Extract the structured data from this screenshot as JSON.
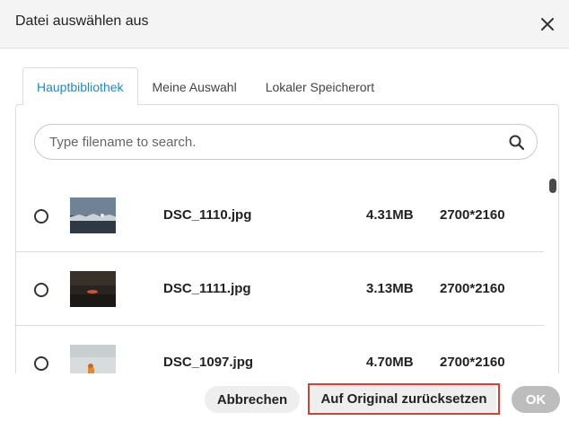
{
  "dialog": {
    "title": "Datei auswählen aus"
  },
  "tabs": [
    {
      "label": "Hauptbibliothek",
      "active": true
    },
    {
      "label": "Meine Auswahl",
      "active": false
    },
    {
      "label": "Lokaler Speicherort",
      "active": false
    }
  ],
  "search": {
    "placeholder": "Type filename to search.",
    "value": ""
  },
  "files": [
    {
      "name": "DSC_1110.jpg",
      "size": "4.31MB",
      "dimensions": "2700*2160",
      "selected": false
    },
    {
      "name": "DSC_1111.jpg",
      "size": "3.13MB",
      "dimensions": "2700*2160",
      "selected": false
    },
    {
      "name": "DSC_1097.jpg",
      "size": "4.70MB",
      "dimensions": "2700*2160",
      "selected": false
    }
  ],
  "footer": {
    "cancel_label": "Abbrechen",
    "reset_label": "Auf Original zurücksetzen",
    "ok_label": "OK"
  },
  "colors": {
    "accent": "#1c8ad4",
    "highlight_border": "#e33a2a",
    "ok_disabled": "#bdbdbd"
  }
}
